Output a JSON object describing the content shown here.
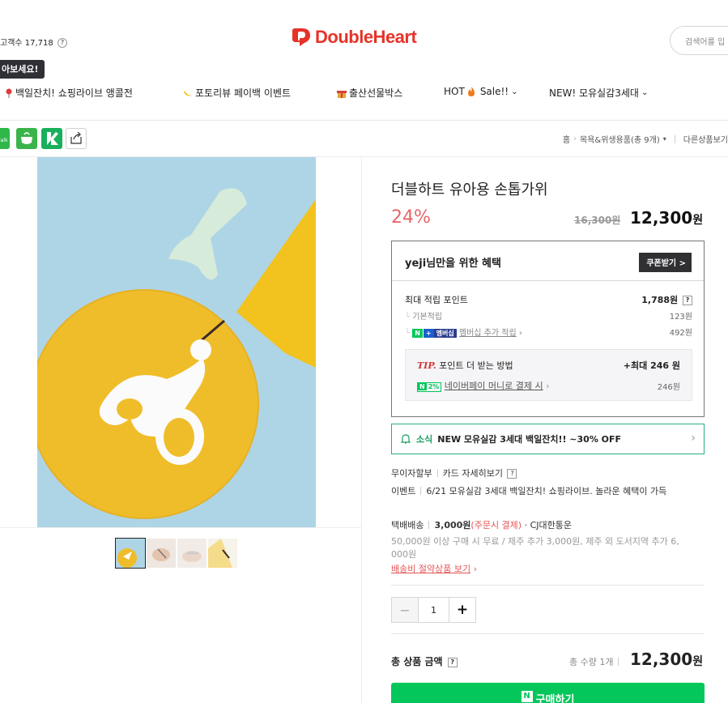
{
  "header": {
    "visitors": "고객수 17,718",
    "help_mark": "?",
    "tooltip": "아보세요!",
    "brand": "DoubleHeart",
    "brand_color": "#e5332a",
    "search_placeholder": "검색어를 입"
  },
  "gnb": [
    {
      "icon": "pin-icon",
      "label": "백일잔치! 쇼핑라이브 앵콜전"
    },
    {
      "icon": "banana-icon",
      "label": "포토리뷰 페이백 이벤트"
    },
    {
      "icon": "gift-icon",
      "label": "출산선물박스"
    },
    {
      "icon": "fire-icon",
      "label": "HOT",
      "label2": "Sale!!",
      "dropdown": "⌄"
    },
    {
      "icon": "",
      "label": "NEW! 모유실감3세대",
      "dropdown": "⌄"
    }
  ],
  "breadcrumb": {
    "home": "홈",
    "category": "목욕&위생용품(총 9개)",
    "other": "다른상품보기"
  },
  "product": {
    "title": "더블하트 유아용 손톱가위",
    "discount": "24%",
    "original_price": "16,300원",
    "price": "12,300",
    "currency": "원"
  },
  "benefit": {
    "heading": "yeji님만을 위한 혜택",
    "coupon_button": "쿠폰받기 >",
    "max_points_label": "최대 적립 포인트",
    "max_points": "1,788원",
    "base_label": "기본적립",
    "base_value": "123원",
    "membership_badge": "멤버십",
    "membership_label": "멤버십 추가 적립",
    "membership_value": "492원",
    "tip_label": "TIP.",
    "tip_text": "포인트 더 받는 방법",
    "tip_value": "+최대 246 원",
    "npay_badge": "2%",
    "npay_label": "네이버페이 머니로 결제 시",
    "npay_value": "246원"
  },
  "news": {
    "tag": "소식",
    "text": "NEW 모유실감 3세대 백일잔치!! ~30% OFF"
  },
  "installment": {
    "label": "무이자할부",
    "card_link": "카드 자세히보기"
  },
  "event": {
    "label": "이벤트",
    "text": "6/21 모유실감 3세대 백일잔치! 쇼핑라이브. 놀라운 혜택이 가득"
  },
  "delivery": {
    "label": "택배배송",
    "fee": "3,000원",
    "fee_note": "(주문시 결제)",
    "carrier": "· CJ대한통운",
    "condition_line1": "50,000원 이상 구매 시 무료 / 제주 추가 3,000원, 제주 외 도서지역 추가 6,",
    "condition_line2": "000원",
    "saving_link": "배송비 절약상품 보기"
  },
  "quantity": {
    "minus": "−",
    "value": "1",
    "plus": "+"
  },
  "total": {
    "label": "총 상품 금액",
    "count": "총 수량 1개",
    "price": "12,300",
    "currency": "원"
  },
  "buy": {
    "npay_mark": "N",
    "label": "구매하기"
  },
  "colors": {
    "accent_green": "#03c75a",
    "discount_red": "#e66767",
    "news_border": "#26b07a"
  }
}
